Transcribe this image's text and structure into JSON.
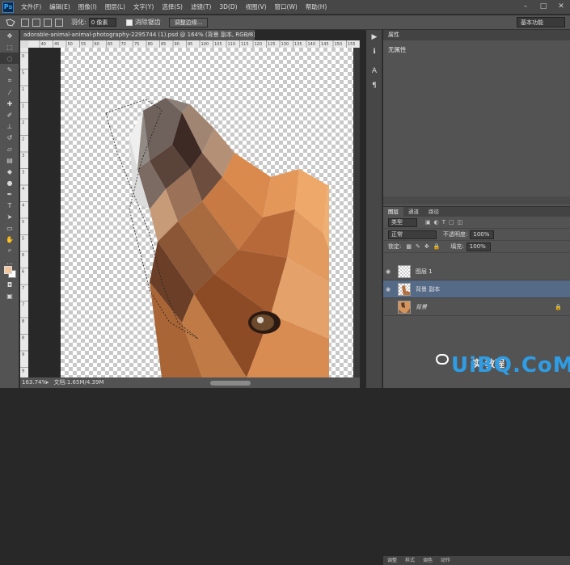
{
  "app": {
    "logo": "Ps",
    "accent": "#31a8ff"
  },
  "menu": [
    "文件(F)",
    "编辑(E)",
    "图像(I)",
    "图层(L)",
    "文字(Y)",
    "选择(S)",
    "滤镜(T)",
    "3D(D)",
    "视图(V)",
    "窗口(W)",
    "帮助(H)"
  ],
  "window_controls": [
    "–",
    "□",
    "✕"
  ],
  "options": {
    "feather_label": "羽化:",
    "feather_value": "0 像素",
    "antialias_label": "消除锯齿",
    "refine_button": "调整边缘...",
    "workspace": "基本功能"
  },
  "document": {
    "tab_title": "adorable-animal-animal-photography-2295744 (1).psd @ 164% (背景 副本, RGB/8) *",
    "ruler_h": [
      "40",
      "45",
      "50",
      "55",
      "60",
      "65",
      "70",
      "75",
      "80",
      "85",
      "90",
      "95",
      "100",
      "105",
      "110",
      "115",
      "120",
      "125",
      "130",
      "135",
      "140",
      "145",
      "150",
      "155",
      "160"
    ],
    "ruler_v": [
      "0",
      "5",
      "1",
      "1",
      "2",
      "2",
      "3",
      "3",
      "4",
      "4",
      "5",
      "5",
      "6",
      "6",
      "7",
      "7",
      "8",
      "8",
      "9",
      "9"
    ],
    "zoom": "163.74%",
    "doc_size": "文档:1.65M/4.39M"
  },
  "properties": {
    "title": "属性",
    "body": "无属性"
  },
  "layers_panel": {
    "tabs": [
      "图层",
      "通道",
      "路径"
    ],
    "filter_kind": "类型",
    "blend_mode": "正常",
    "opacity_label": "不透明度:",
    "opacity": "100%",
    "lock_label": "锁定:",
    "fill_label": "填充:",
    "fill": "100%",
    "layers": [
      {
        "name": "图层 1",
        "visible": true,
        "active": false
      },
      {
        "name": "背景 副本",
        "visible": true,
        "active": true
      },
      {
        "name": "背景",
        "visible": false,
        "active": false,
        "locked": true
      }
    ],
    "bottom_tabs": [
      "调整",
      "样式",
      "调色",
      "动作"
    ]
  },
  "watermark": {
    "text": "UiBQ.CoM",
    "sub": "实 教程"
  }
}
